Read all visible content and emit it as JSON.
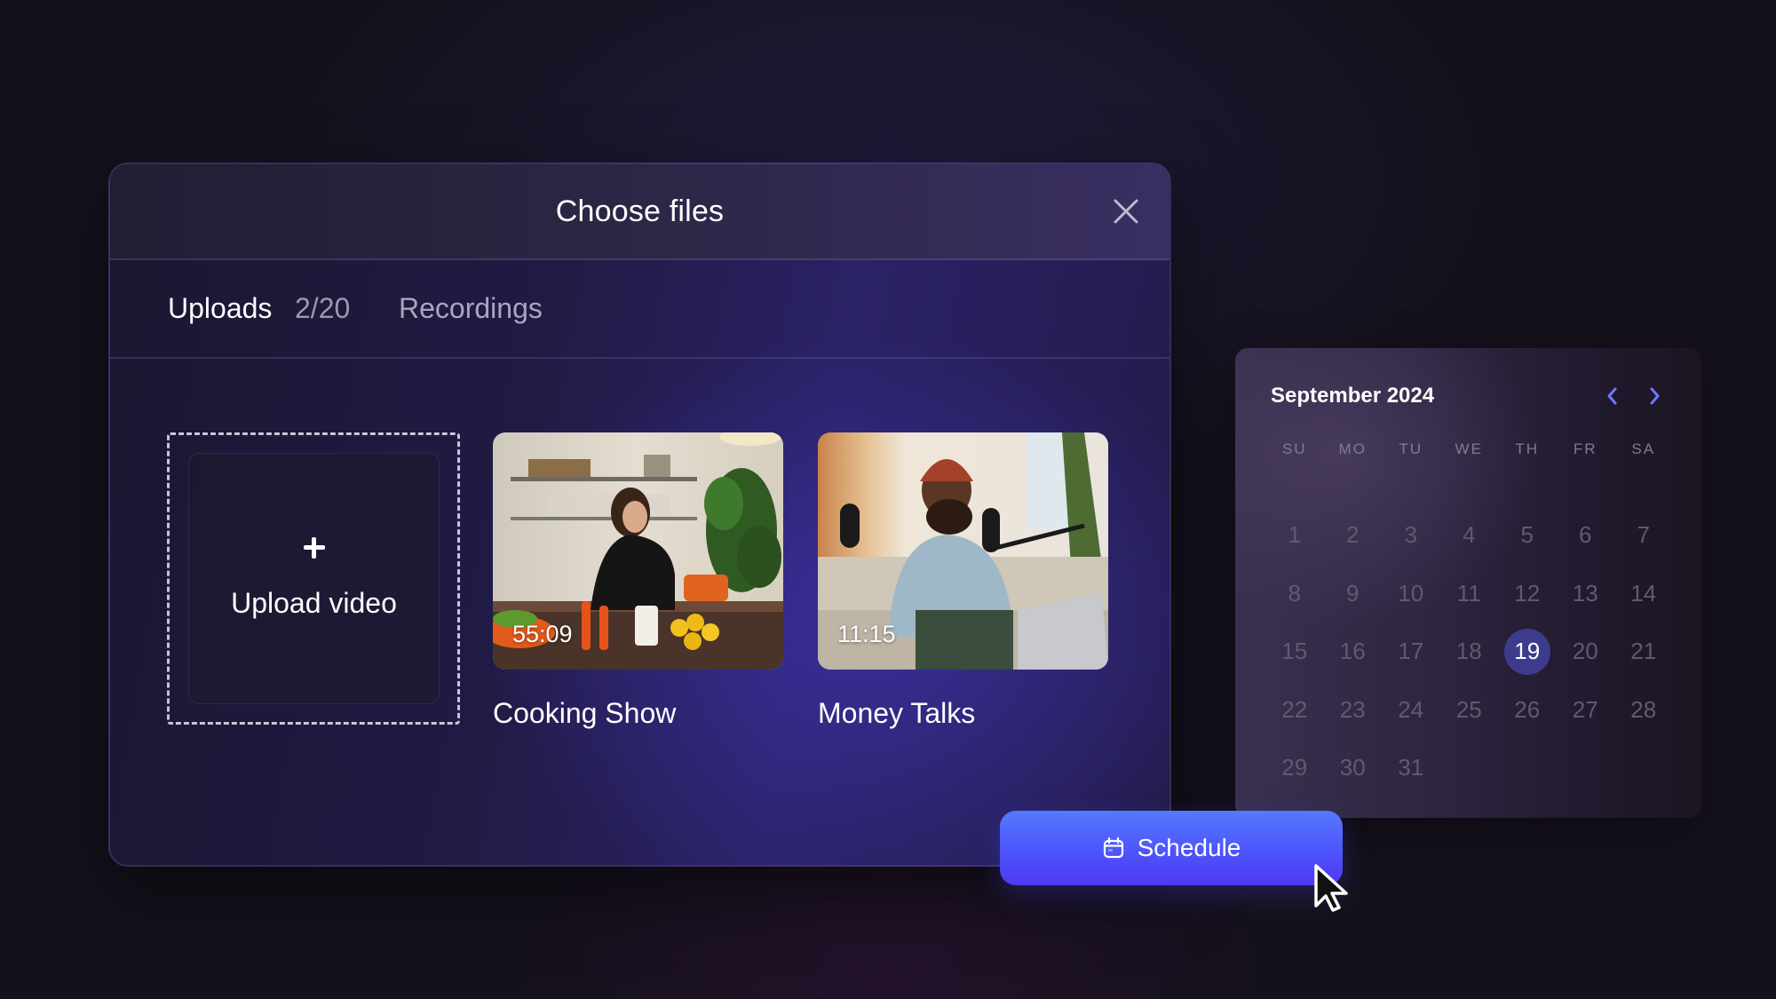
{
  "modal": {
    "title": "Choose files",
    "close_icon": "close-icon",
    "tabs": [
      {
        "label": "Uploads",
        "count": "2/20",
        "active": true
      },
      {
        "label": "Recordings",
        "active": false
      }
    ],
    "upload": {
      "icon": "plus-icon",
      "label": "Upload video"
    },
    "videos": [
      {
        "title": "Cooking Show",
        "duration": "55:09"
      },
      {
        "title": "Money Talks",
        "duration": "11:15"
      }
    ]
  },
  "calendar": {
    "title": "September 2024",
    "prev_icon": "chevron-left-icon",
    "next_icon": "chevron-right-icon",
    "weekdays": [
      "SU",
      "MO",
      "TU",
      "WE",
      "TH",
      "FR",
      "SA"
    ],
    "weeks": [
      [
        "1",
        "2",
        "3",
        "4",
        "5",
        "6",
        "7"
      ],
      [
        "8",
        "9",
        "10",
        "11",
        "12",
        "13",
        "14"
      ],
      [
        "15",
        "16",
        "17",
        "18",
        "19",
        "20",
        "21"
      ],
      [
        "22",
        "23",
        "24",
        "25",
        "26",
        "27",
        "28"
      ],
      [
        "29",
        "30",
        "31",
        "",
        "",
        "",
        ""
      ]
    ],
    "selected_day": "19"
  },
  "schedule_button": {
    "icon": "calendar-icon",
    "label": "Schedule"
  },
  "colors": {
    "accent": "#4d55fb",
    "selected_day": "#3d3c8c",
    "nav_arrow": "#6f78ff"
  }
}
